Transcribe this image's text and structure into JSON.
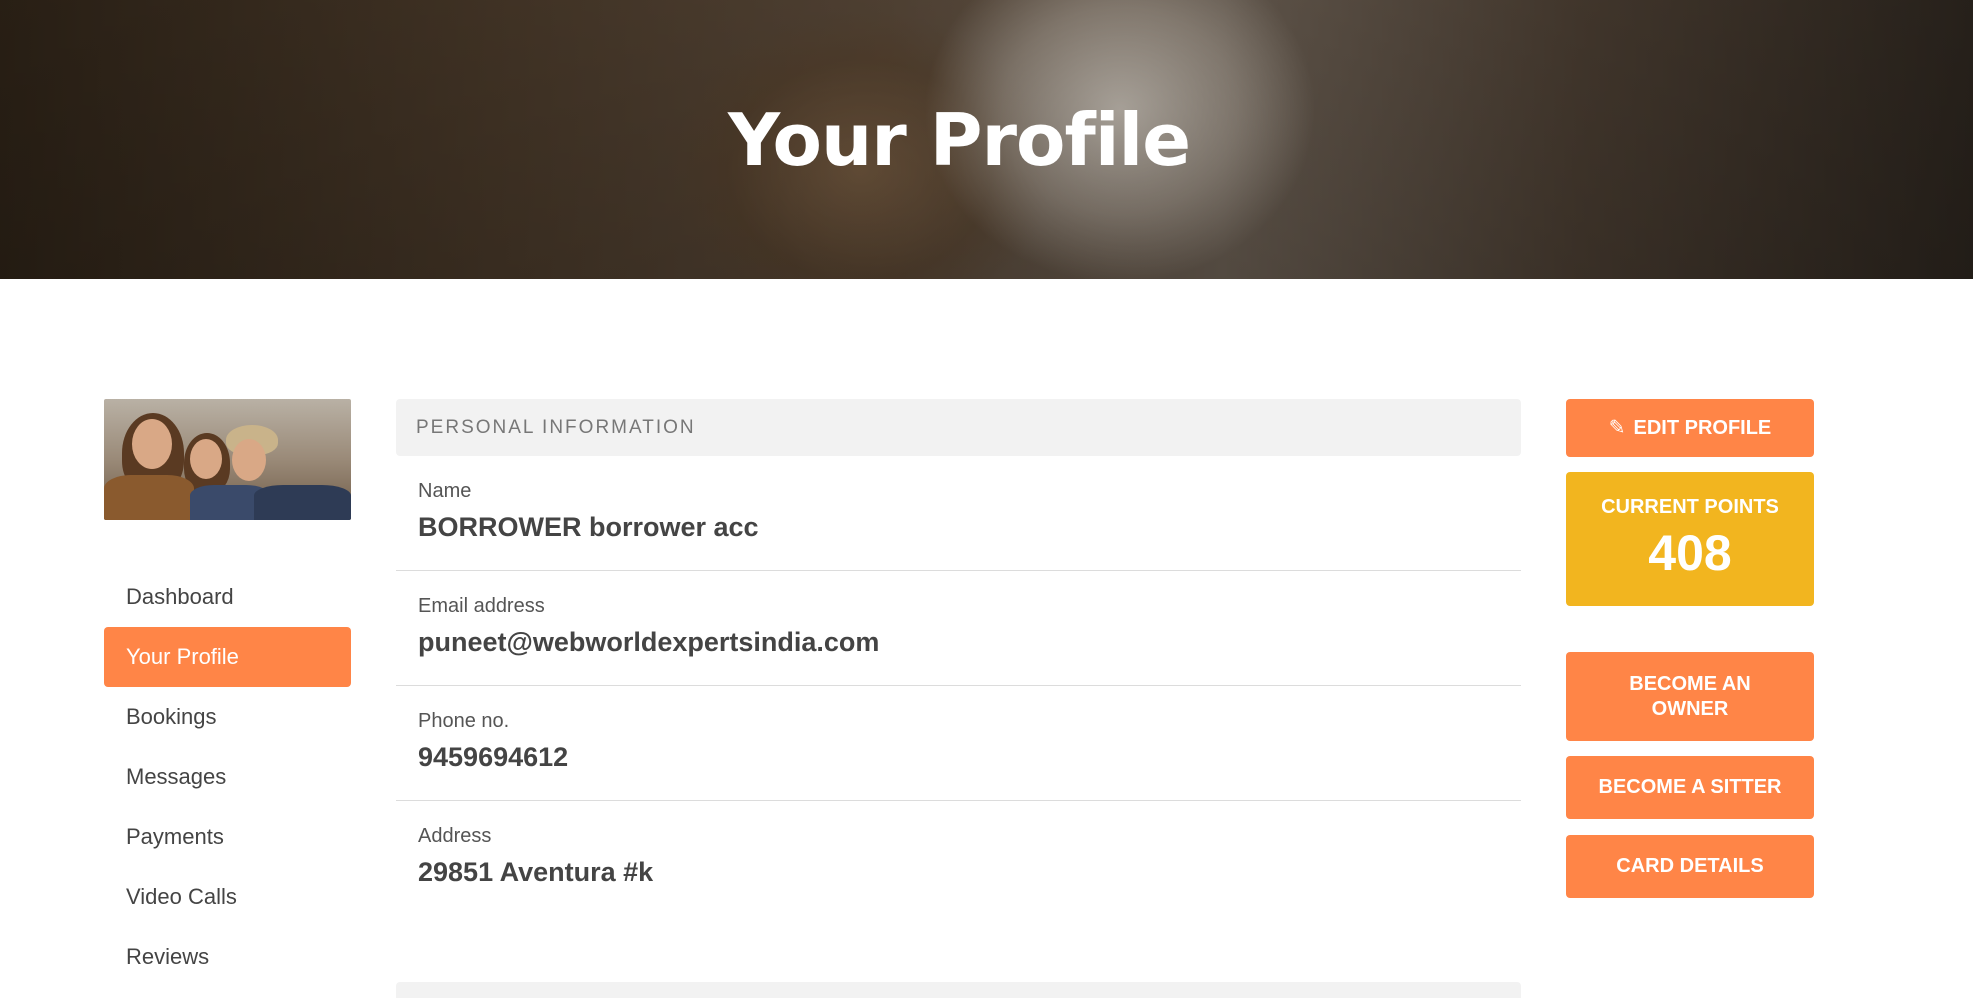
{
  "hero": {
    "title": "Your Profile"
  },
  "sidebar": {
    "items": [
      {
        "label": "Dashboard",
        "active": false
      },
      {
        "label": "Your Profile",
        "active": true
      },
      {
        "label": "Bookings",
        "active": false
      },
      {
        "label": "Messages",
        "active": false
      },
      {
        "label": "Payments",
        "active": false
      },
      {
        "label": "Video Calls",
        "active": false
      },
      {
        "label": "Reviews",
        "active": false
      }
    ]
  },
  "personal_info": {
    "header": "PERSONAL INFORMATION",
    "fields": [
      {
        "label": "Name",
        "value": "BORROWER borrower acc"
      },
      {
        "label": "Email address",
        "value": "puneet@webworldexpertsindia.com"
      },
      {
        "label": "Phone no.",
        "value": "9459694612"
      },
      {
        "label": "Address",
        "value": "29851 Aventura #k"
      }
    ]
  },
  "actions": {
    "edit_profile": "EDIT PROFILE",
    "points_label": "CURRENT POINTS",
    "points_value": "408",
    "become_owner": "BECOME AN OWNER",
    "become_sitter": "BECOME A SITTER",
    "card_details": "CARD DETAILS"
  },
  "colors": {
    "accent": "#ff8547",
    "points": "#f2b51f",
    "header_bg": "#f2f2f2"
  },
  "icons": {
    "edit": "pencil-icon"
  }
}
